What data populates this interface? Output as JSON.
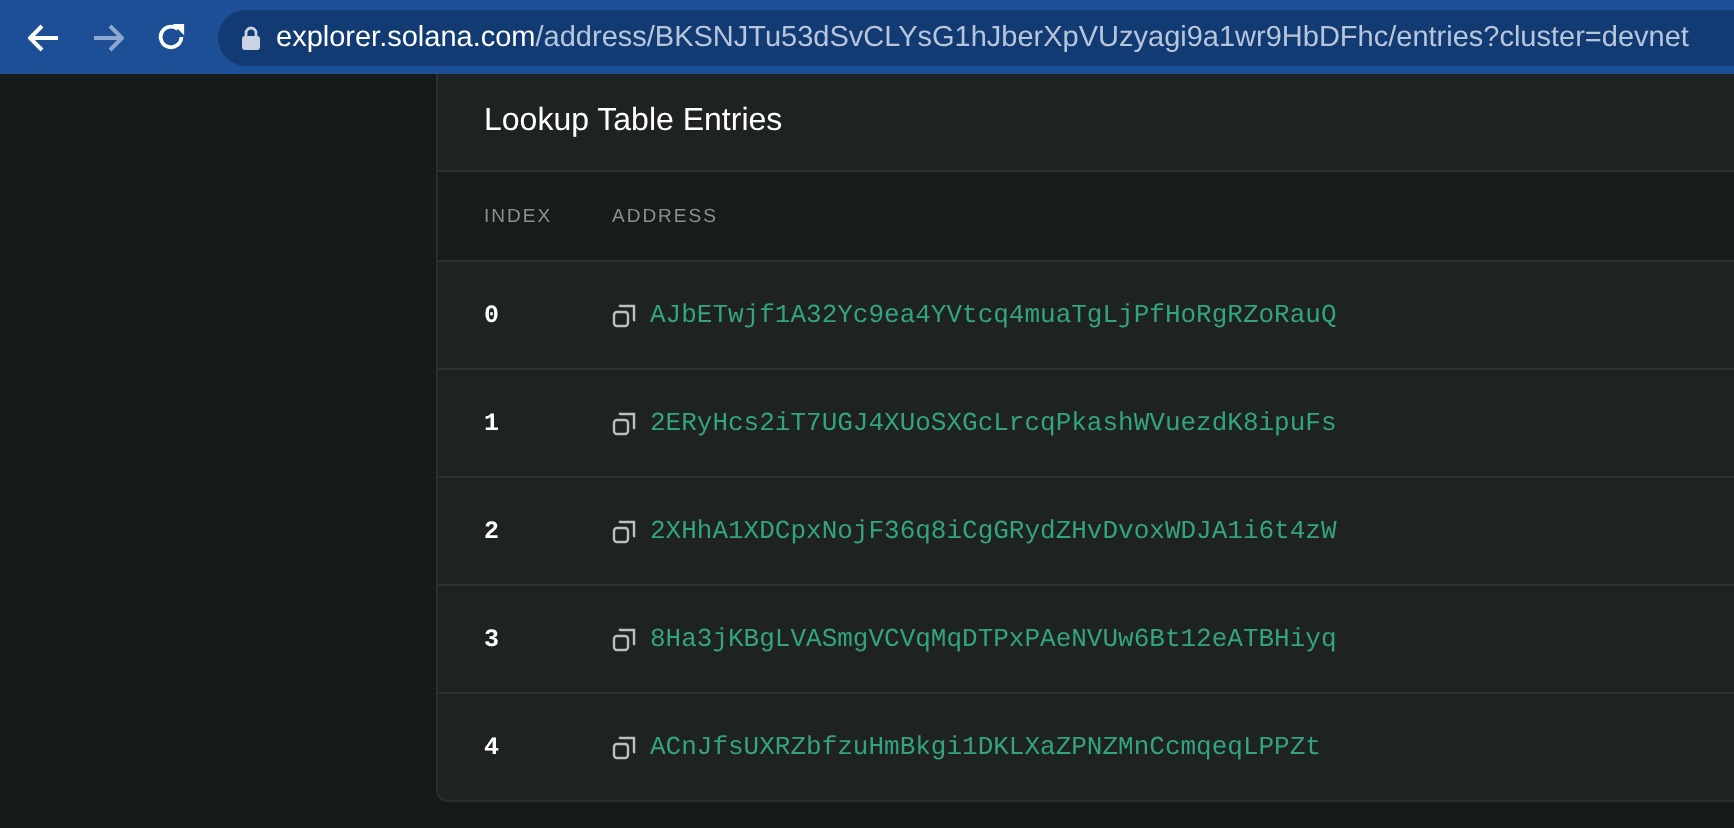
{
  "browser": {
    "url_host": "explorer.solana.com",
    "url_path": "/address/BKSNJTu53dSvCLYsG1hJberXpVUzyagi9a1wr9HbDFhc/entries?cluster=devnet"
  },
  "card": {
    "title": "Lookup Table Entries",
    "table": {
      "columns": [
        "INDEX",
        "ADDRESS"
      ],
      "rows": [
        {
          "index": "0",
          "address": "AJbETwjf1A32Yc9ea4YVtcq4muaTgLjPfHoRgRZoRauQ"
        },
        {
          "index": "1",
          "address": "2ERyHcs2iT7UGJ4XUoSXGcLrcqPkashWVuezdK8ipuFs"
        },
        {
          "index": "2",
          "address": "2XHhA1XDCpxNojF36q8iCgGRydZHvDvoxWDJA1i6t4zW"
        },
        {
          "index": "3",
          "address": "8Ha3jKBgLVASmgVCVqMqDTPxPAeNVUw6Bt12eATBHiyq"
        },
        {
          "index": "4",
          "address": "ACnJfsUXRZbfzuHmBkgi1DKLXaZPNZMnCcmqeqLPPZt"
        }
      ]
    }
  }
}
